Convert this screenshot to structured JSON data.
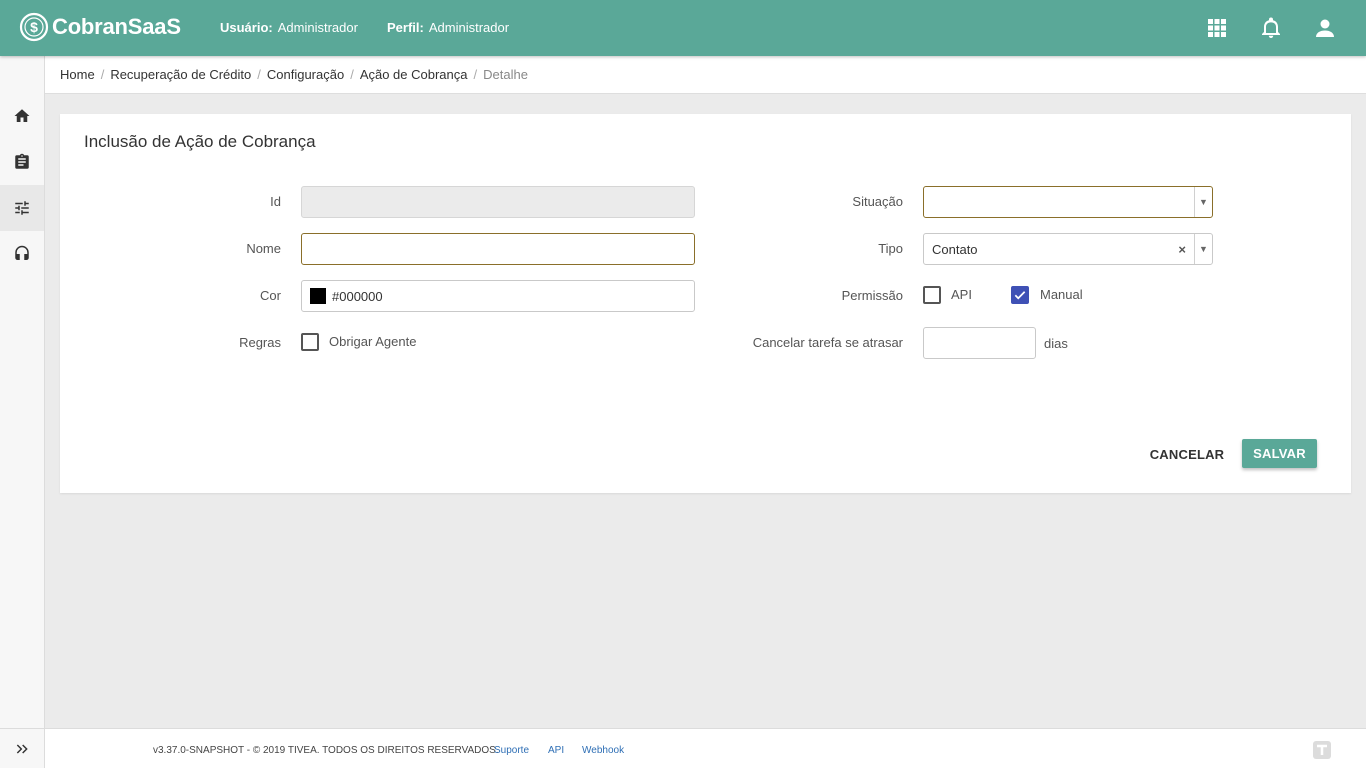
{
  "app": {
    "name": "CobranSaaS"
  },
  "header": {
    "user_label": "Usuário:",
    "user_value": "Administrador",
    "profile_label": "Perfil:",
    "profile_value": "Administrador"
  },
  "breadcrumb": [
    "Home",
    "Recuperação de Crédito",
    "Configuração",
    "Ação de Cobrança",
    "Detalhe"
  ],
  "form": {
    "title": "Inclusão de Ação de Cobrança",
    "id_label": "Id",
    "id_value": "",
    "nome_label": "Nome",
    "nome_value": "",
    "cor_label": "Cor",
    "cor_value": "#000000",
    "regras_label": "Regras",
    "obrigar_agente_label": "Obrigar Agente",
    "obrigar_agente_checked": false,
    "situacao_label": "Situação",
    "situacao_value": "",
    "tipo_label": "Tipo",
    "tipo_value": "Contato",
    "permissao_label": "Permissão",
    "api_label": "API",
    "api_checked": false,
    "manual_label": "Manual",
    "manual_checked": true,
    "cancelar_label": "Cancelar tarefa se atrasar",
    "cancelar_value": "",
    "dias_label": "dias"
  },
  "actions": {
    "cancel_label": "CANCELAR",
    "save_label": "SALVAR"
  },
  "footer": {
    "text": "v3.37.0-SNAPSHOT - © 2019 TIVEA. TODOS OS DIREITOS RESERVADOS.",
    "links": [
      "Suporte",
      "API",
      "Webhook"
    ]
  },
  "colors": {
    "primary": "#5aa898",
    "checkbox_checked": "#3f51b5",
    "focus_border": "#8a6f2a"
  }
}
